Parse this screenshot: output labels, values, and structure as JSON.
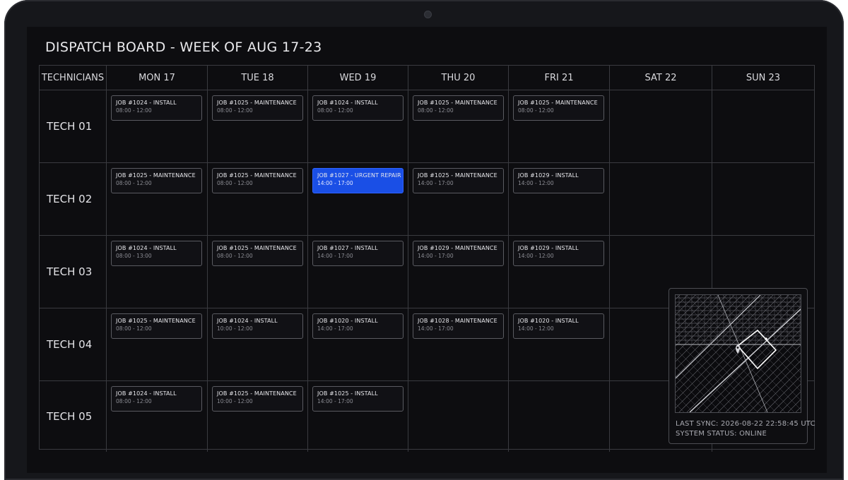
{
  "board": {
    "title": "DISPATCH BOARD - WEEK OF AUG 17-23",
    "corner_header": "TECHNICIANS",
    "days": [
      "MON 17",
      "TUE 18",
      "WED 19",
      "THU 20",
      "FRI 21",
      "SAT 22",
      "SUN 23"
    ],
    "technicians": [
      {
        "name": "TECH 01",
        "jobs": [
          {
            "title": "JOB #1024 - INSTALL",
            "time": "08:00 - 12:00"
          },
          {
            "title": "JOB #1025 - MAINTENANCE",
            "time": "08:00 - 12:00"
          },
          {
            "title": "JOB #1024 - INSTALL",
            "time": "08:00 - 12:00"
          },
          {
            "title": "JOB #1025 - MAINTENANCE",
            "time": "08:00 - 12:00"
          },
          {
            "title": "JOB #1025 - MAINTENANCE",
            "time": "08:00 - 12:00"
          },
          null,
          null
        ]
      },
      {
        "name": "TECH 02",
        "jobs": [
          {
            "title": "JOB #1025 - MAINTENANCE",
            "time": "08:00 - 12:00"
          },
          {
            "title": "JOB #1025 - MAINTENANCE",
            "time": "08:00 - 12:00"
          },
          {
            "title": "JOB #1027 - URGENT REPAIR",
            "time": "14:00 - 17:00",
            "urgent": true
          },
          {
            "title": "JOB #1025 - MAINTENANCE",
            "time": "14:00 - 17:00"
          },
          {
            "title": "JOB #1029 - INSTALL",
            "time": "14:00 - 12:00"
          },
          null,
          null
        ]
      },
      {
        "name": "TECH 03",
        "jobs": [
          {
            "title": "JOB #1024 - INSTALL",
            "time": "08:00 - 13:00"
          },
          {
            "title": "JOB #1025 - MAINTENANCE",
            "time": "08:00 - 12:00"
          },
          {
            "title": "JOB #1027 - INSTALL",
            "time": "14:00 - 17:00"
          },
          {
            "title": "JOB #1029 - MAINTENANCE",
            "time": "14:00 - 17:00"
          },
          {
            "title": "JOB #1029 - INSTALL",
            "time": "14:00 - 12:00"
          },
          null,
          null
        ]
      },
      {
        "name": "TECH 04",
        "jobs": [
          {
            "title": "JOB #1025 - MAINTENANCE",
            "time": "08:00 - 12:00"
          },
          {
            "title": "JOB #1024 - INSTALL",
            "time": "10:00 - 12:00"
          },
          {
            "title": "JOB #1020 - INSTALL",
            "time": "14:00 - 17:00"
          },
          {
            "title": "JOB #1028 - MAINTENANCE",
            "time": "14:00 - 17:00"
          },
          {
            "title": "JOB #1020 - INSTALL",
            "time": "14:00 - 12:00"
          },
          null,
          null
        ]
      },
      {
        "name": "TECH 05",
        "jobs": [
          {
            "title": "JOB #1024 - INSTALL",
            "time": "08:00 - 12:00"
          },
          {
            "title": "JOB #1025 - MAINTENANCE",
            "time": "10:00 - 12:00"
          },
          {
            "title": "JOB #1025 - INSTALL",
            "time": "14:00 - 17:00"
          },
          null,
          null,
          null,
          null
        ]
      }
    ]
  },
  "map": {
    "last_sync": "LAST SYNC: 2026-08-22 22:58:45 UTC",
    "system_status": "SYSTEM STATUS: ONLINE",
    "pin_icon": "location-pin-icon"
  },
  "colors": {
    "background": "#0d0d10",
    "grid_line": "#3a3b40",
    "card_border": "#5a5b61",
    "urgent": "#1a4fe6",
    "text": "#e4e4e8",
    "muted_text": "#8c8d94"
  }
}
